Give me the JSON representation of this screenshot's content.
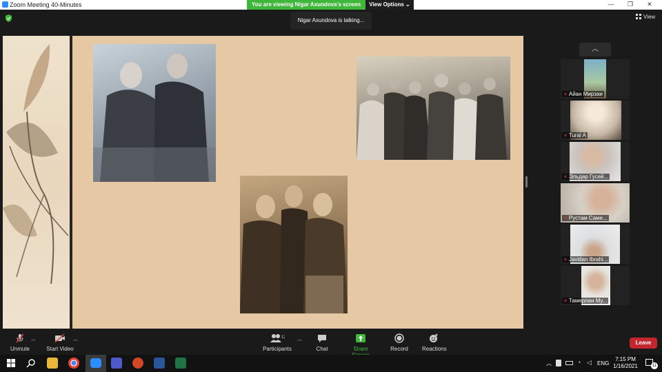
{
  "window": {
    "title": "Zoom Meeting 40-Minutes",
    "minimize": "—",
    "maximize": "❐",
    "close": "✕"
  },
  "banner": {
    "viewing": "You are viewing Nigar Axundova's screen",
    "view_options": "View Options ⌄"
  },
  "talking": "Nigar Axundova is talking...",
  "view_label": "View",
  "participants_tiles": [
    {
      "name": "Айан Мирзаи"
    },
    {
      "name": "Tural A"
    },
    {
      "name": "Эльдар Гусей..."
    },
    {
      "name": "Рустам Саме..."
    },
    {
      "name": "Javidan Ibrahi..."
    },
    {
      "name": "Тамерлан Му..."
    }
  ],
  "toolbar": {
    "unmute": "Unmute",
    "start_video": "Start Video",
    "participants": "Participants",
    "participants_count": "12",
    "chat": "Chat",
    "share_screen": "Share Screen",
    "record": "Record",
    "reactions": "Reactions",
    "leave": "Leave"
  },
  "colors": {
    "share_green": "#3fb73a",
    "leave_red": "#c4262e",
    "slide_bg": "#e6c9a4",
    "mic_muted": "#e03a3a"
  },
  "tray": {
    "lang": "ENG",
    "time": "7:15 PM",
    "date": "1/16/2021",
    "notifications": "11"
  }
}
